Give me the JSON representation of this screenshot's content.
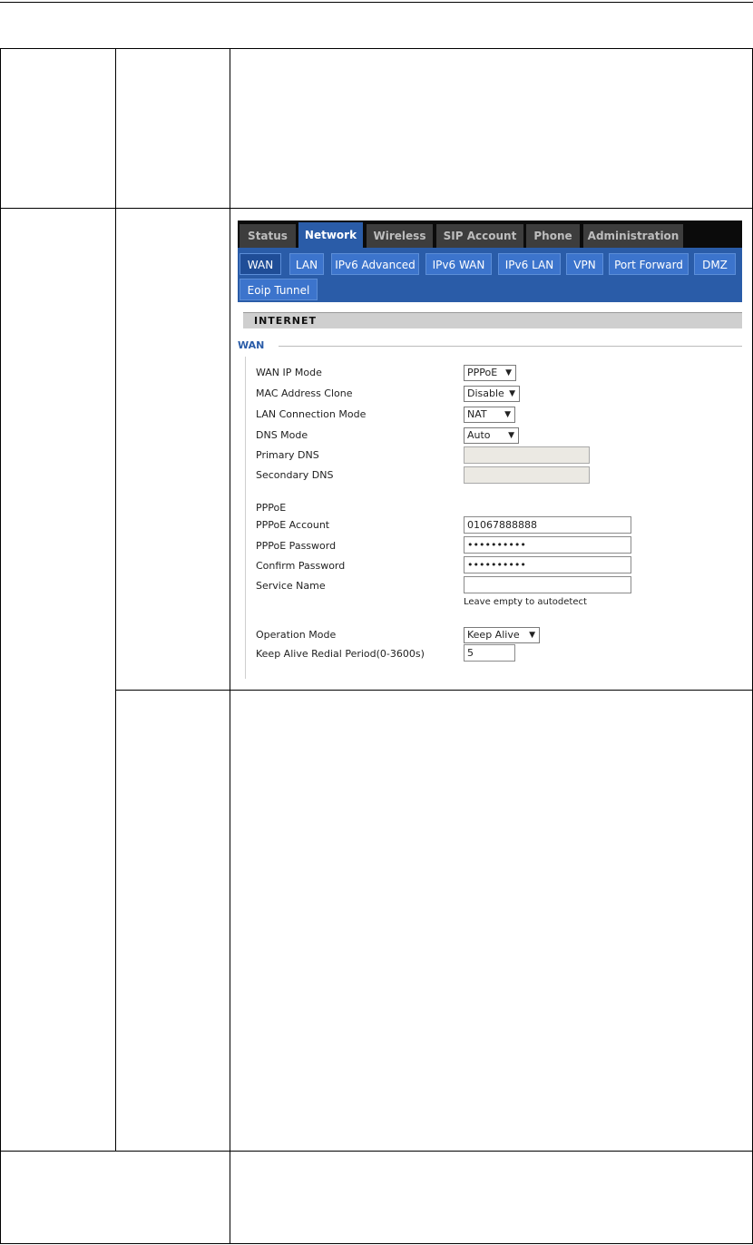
{
  "topnav": [
    {
      "label": "Status",
      "active": false
    },
    {
      "label": "Network",
      "active": true
    },
    {
      "label": "Wireless",
      "active": false
    },
    {
      "label": "SIP Account",
      "active": false
    },
    {
      "label": "Phone",
      "active": false
    },
    {
      "label": "Administration",
      "active": false
    }
  ],
  "subnav": [
    {
      "label": "WAN",
      "active": true
    },
    {
      "label": "LAN",
      "active": false
    },
    {
      "label": "IPv6 Advanced",
      "active": false
    },
    {
      "label": "IPv6 WAN",
      "active": false
    },
    {
      "label": "IPv6 LAN",
      "active": false
    },
    {
      "label": "VPN",
      "active": false
    },
    {
      "label": "Port Forward",
      "active": false
    },
    {
      "label": "DMZ",
      "active": false
    },
    {
      "label": "Eoip Tunnel",
      "active": false
    }
  ],
  "section_title": "INTERNET",
  "group_legend": "WAN",
  "fields": {
    "wan_ip_mode": {
      "label": "WAN IP Mode",
      "value": "PPPoE"
    },
    "mac_clone": {
      "label": "MAC Address Clone",
      "value": "Disable"
    },
    "lan_conn_mode": {
      "label": "LAN Connection Mode",
      "value": "NAT"
    },
    "dns_mode": {
      "label": "DNS Mode",
      "value": "Auto"
    },
    "primary_dns": {
      "label": "Primary DNS",
      "value": ""
    },
    "secondary_dns": {
      "label": "Secondary DNS",
      "value": ""
    },
    "pppoe_heading": "PPPoE",
    "pppoe_account": {
      "label": "PPPoE Account",
      "value": "01067888888"
    },
    "pppoe_password": {
      "label": "PPPoE Password",
      "value": "••••••••••"
    },
    "confirm_password": {
      "label": "Confirm Password",
      "value": "••••••••••"
    },
    "service_name": {
      "label": "Service Name",
      "value": "",
      "hint": "Leave empty to autodetect"
    },
    "operation_mode": {
      "label": "Operation Mode",
      "value": "Keep Alive"
    },
    "keep_alive": {
      "label": "Keep Alive Redial Period(0-3600s)",
      "value": "5"
    }
  },
  "icons": {
    "dropdown": "dropdown-arrow-icon"
  }
}
